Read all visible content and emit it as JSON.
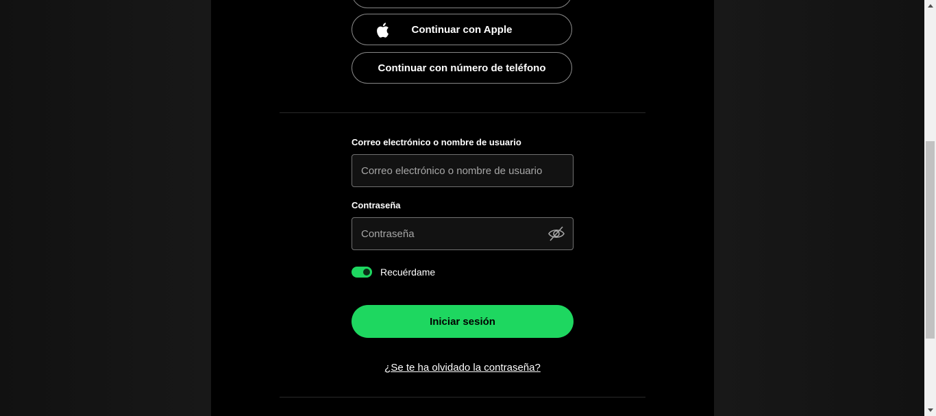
{
  "auth": {
    "google_label": "",
    "apple_label": "Continuar con Apple",
    "phone_label": "Continuar con número de teléfono"
  },
  "form": {
    "email_label": "Correo electrónico o nombre de usuario",
    "email_placeholder": "Correo electrónico o nombre de usuario",
    "email_value": "",
    "password_label": "Contraseña",
    "password_placeholder": "Contraseña",
    "password_value": "",
    "remember_label": "Recuérdame",
    "remember_checked": true,
    "login_label": "Iniciar sesión",
    "forgot_label": "¿Se te ha olvidado la contraseña?"
  },
  "icons": {
    "apple": "apple-icon",
    "password_visibility": "eye-slash-icon",
    "scroll_up": "scroll-up-icon",
    "scroll_down": "scroll-down-icon"
  },
  "colors": {
    "accent": "#1ed760",
    "background": "#000000",
    "page_background": "#121212",
    "border": "#878787",
    "text": "#ffffff",
    "placeholder": "#a7a7a7"
  }
}
